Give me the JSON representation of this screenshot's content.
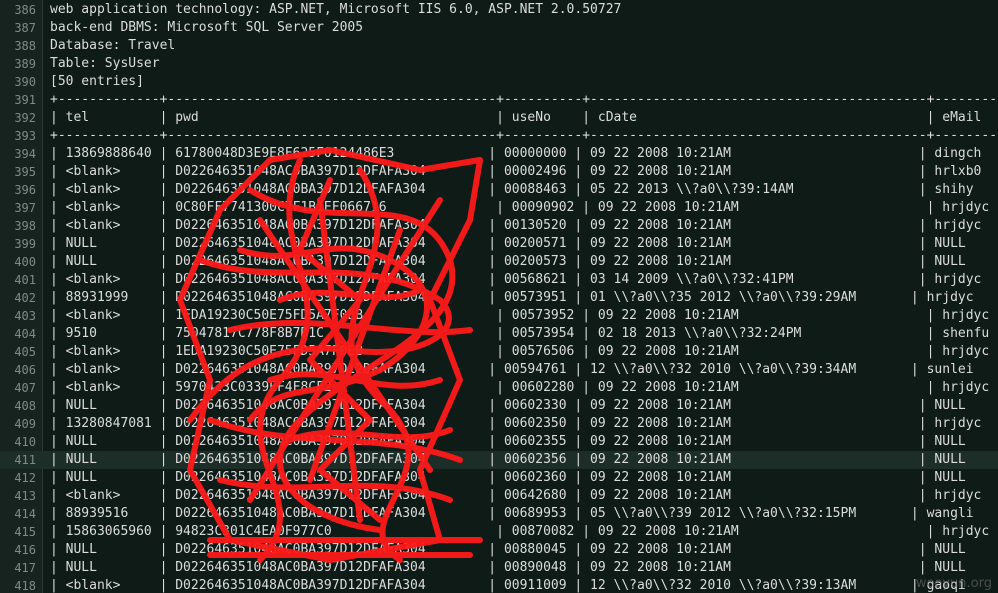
{
  "editor": {
    "lines": [
      {
        "num": "386",
        "text": "web application technology: ASP.NET, Microsoft IIS 6.0, ASP.NET 2.0.50727"
      },
      {
        "num": "387",
        "text": "back-end DBMS: Microsoft SQL Server 2005"
      },
      {
        "num": "388",
        "text": "Database: Travel"
      },
      {
        "num": "389",
        "text": "Table: SysUser"
      },
      {
        "num": "390",
        "text": "[50 entries]"
      },
      {
        "num": "391",
        "text": "+-------------+------------------------------------------+----------+-------------------------------------------+------------"
      },
      {
        "num": "392",
        "text": "| tel         | pwd                                      | useNo    | cDate                                     | eMail"
      },
      {
        "num": "393",
        "text": "+-------------+------------------------------------------+----------+-------------------------------------------+------------"
      },
      {
        "num": "394",
        "text": "| 13869888640 | 61780048D3E9E8F625F0124486E3            | 00000000 | 09 22 2008 10:21AM                        | dingch"
      },
      {
        "num": "395",
        "text": "| <blank>     | D022646351048AC0BA397D12DFAFA304        | 00002496 | 09 22 2008 10:21AM                        | hrlxb0"
      },
      {
        "num": "396",
        "text": "| <blank>     | D022646351048AC0BA397D12DFAFA304        | 00088463 | 05 22 2013 \\\\?a0\\\\?39:14AM                | shihy"
      },
      {
        "num": "397",
        "text": "| <blank>     | 0C80FF7741300C7F1B1EF066716              | 00090902 | 09 22 2008 10:21AM                        | hrjdyc"
      },
      {
        "num": "398",
        "text": "| <blank>     | D022646351048AC0BA397D12DFAFA304        | 00130520 | 09 22 2008 10:21AM                        | hrjdyc"
      },
      {
        "num": "399",
        "text": "| NULL        | D022646351048AC0BA397D12DFAFA304        | 00200571 | 09 22 2008 10:21AM                        | NULL"
      },
      {
        "num": "400",
        "text": "| NULL        | D022646351048AC0BA397D12DFAFA304        | 00200573 | 09 22 2008 10:21AM                        | NULL"
      },
      {
        "num": "401",
        "text": "| <blank>     | D022646351048AC0BA397D12DFAFA304        | 00568621 | 03 14 2009 \\\\?a0\\\\?32:41PM                | hrjdyc"
      },
      {
        "num": "402",
        "text": "| 88931999    | D022646351048AC0BA397D12DFAFA304        | 00573951 | 01 \\\\?a0\\\\?35 2012 \\\\?a0\\\\?39:29AM       | hrjdyc"
      },
      {
        "num": "403",
        "text": "| <blank>     | 1EDA19230C50E75FD5A7F0EB                 | 00573952 | 09 22 2008 10:21AM                        | hrjdyc"
      },
      {
        "num": "404",
        "text": "| 9510        | 75047817C778F8B7D1C                      | 00573954 | 02 18 2013 \\\\?a0\\\\?32:24PM                | shenfu"
      },
      {
        "num": "405",
        "text": "| <blank>     | 1EDA19230C50E75FD5A7F0EB                 | 00576506 | 09 22 2008 10:21AM                        | hrjdyc"
      },
      {
        "num": "406",
        "text": "| <blank>     | D022646351048AC0BA397D12DFAFA304        | 00594761 | 12 \\\\?a0\\\\?32 2010 \\\\?a0\\\\?39:34AM       | sunlei"
      },
      {
        "num": "407",
        "text": "| <blank>     | 5970423C0339EF4F8CF2                     | 00602280 | 09 22 2008 10:21AM                        | hrjdyc"
      },
      {
        "num": "408",
        "text": "| NULL        | D022646351048AC0BA397D12DFAFA304        | 00602330 | 09 22 2008 10:21AM                        | NULL"
      },
      {
        "num": "409",
        "text": "| 13280847081 | D022646351048AC0BA397D12DFAFA304        | 00602350 | 09 22 2008 10:21AM                        | hrjdyc"
      },
      {
        "num": "410",
        "text": "| NULL        | D022646351048AC0BA397D12DFAFA304        | 00602355 | 09 22 2008 10:21AM                        | NULL"
      },
      {
        "num": "411",
        "text": "| NULL        | D022646351048AC0BA397D12DFAFA304        | 00602356 | 09 22 2008 10:21AM                        | NULL"
      },
      {
        "num": "412",
        "text": "| NULL        | D022646351048AC0BA397D12DFAFA304        | 00602360 | 09 22 2008 10:21AM                        | NULL"
      },
      {
        "num": "413",
        "text": "| <blank>     | D022646351048AC0BA397D12DFAFA304        | 00642680 | 09 22 2008 10:21AM                        | hrjdyc"
      },
      {
        "num": "414",
        "text": "| 88939516    | D022646351048AC0BA397D12DFAFA304        | 00689953 | 05 \\\\?a0\\\\?39 2012 \\\\?a0\\\\?32:15PM       | wangli"
      },
      {
        "num": "415",
        "text": "| 15863065960 | 94823C301C4EA0F977C0                     | 00870082 | 09 22 2008 10:21AM                        | hrjdyc"
      },
      {
        "num": "416",
        "text": "| NULL        | D022646351048AC0BA397D12DFAFA304        | 00880045 | 09 22 2008 10:21AM                        | NULL"
      },
      {
        "num": "417",
        "text": "| NULL        | D022646351048AC0BA397D12DFAFA304        | 00890048 | 09 22 2008 10:21AM                        | NULL"
      },
      {
        "num": "418",
        "text": "| <blank>     | D022646351048AC0BA397D12DFAFA304        | 00911009 | 12 \\\\?a0\\\\?32 2010 \\\\?a0\\\\?39:13AM       | gaoqi"
      }
    ],
    "current_line": 25
  },
  "watermark": "wooyun.org"
}
